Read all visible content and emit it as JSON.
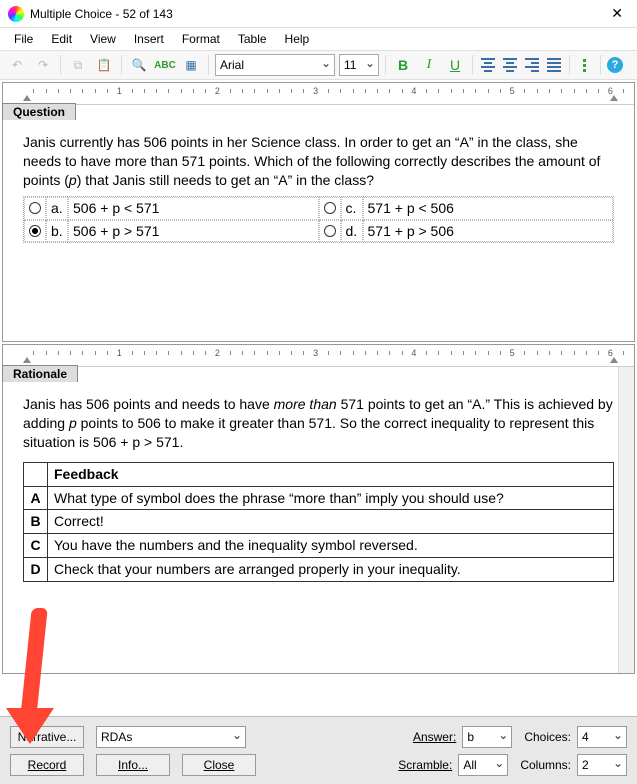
{
  "title": "Multiple Choice - 52 of 143",
  "menu": {
    "file": "File",
    "edit": "Edit",
    "view": "View",
    "insert": "Insert",
    "format": "Format",
    "table": "Table",
    "help": "Help"
  },
  "toolbar": {
    "font": "Arial",
    "size": "11"
  },
  "ruler_numbers": [
    "1",
    "2",
    "3",
    "4",
    "5",
    "6"
  ],
  "question_tab": "Question",
  "rationale_tab": "Rationale",
  "question_text_1": "Janis currently has 506 points in her Science class. In order to get an “A” in the class, she needs to have more than 571 points. Which of the following correctly describes the amount of points (",
  "question_var": "p",
  "question_text_2": ") that Janis still needs to get an “A” in the class?",
  "answers": {
    "a_lab": "a.",
    "a_txt": "506 + p < 571",
    "b_lab": "b.",
    "b_txt": "506 + p > 571",
    "c_lab": "c.",
    "c_txt": "571 + p < 506",
    "d_lab": "d.",
    "d_txt": "571 + p > 506",
    "selected": "b"
  },
  "rationale_1": "Janis has 506 points and needs to have ",
  "rationale_more": "more than",
  "rationale_2": " 571 points to get an “A.” This is achieved by adding ",
  "rationale_p": "p",
  "rationale_3": " points to 506 to make it greater than 571. So the correct inequality to represent this situation is 506 + p > 571.",
  "feedback_header": "Feedback",
  "feedback": {
    "A_lab": "A",
    "A": "What type of symbol does the phrase “more than” imply you should use?",
    "B_lab": "B",
    "B": "Correct!",
    "C_lab": "C",
    "C": "You have the numbers and the inequality symbol reversed.",
    "D_lab": "D",
    "D": "Check that your numbers are arranged properly in your inequality."
  },
  "bottom": {
    "narrative_btn": "Narrative...",
    "rdas": "RDAs",
    "answer_lbl": "Answer:",
    "answer_val": "b",
    "choices_lbl": "Choices:",
    "choices_val": "4",
    "record_btn": "Record",
    "info_btn": "Info...",
    "close_btn": "Close",
    "scramble_lbl": "Scramble:",
    "scramble_val": "All",
    "columns_lbl": "Columns:",
    "columns_val": "2"
  }
}
